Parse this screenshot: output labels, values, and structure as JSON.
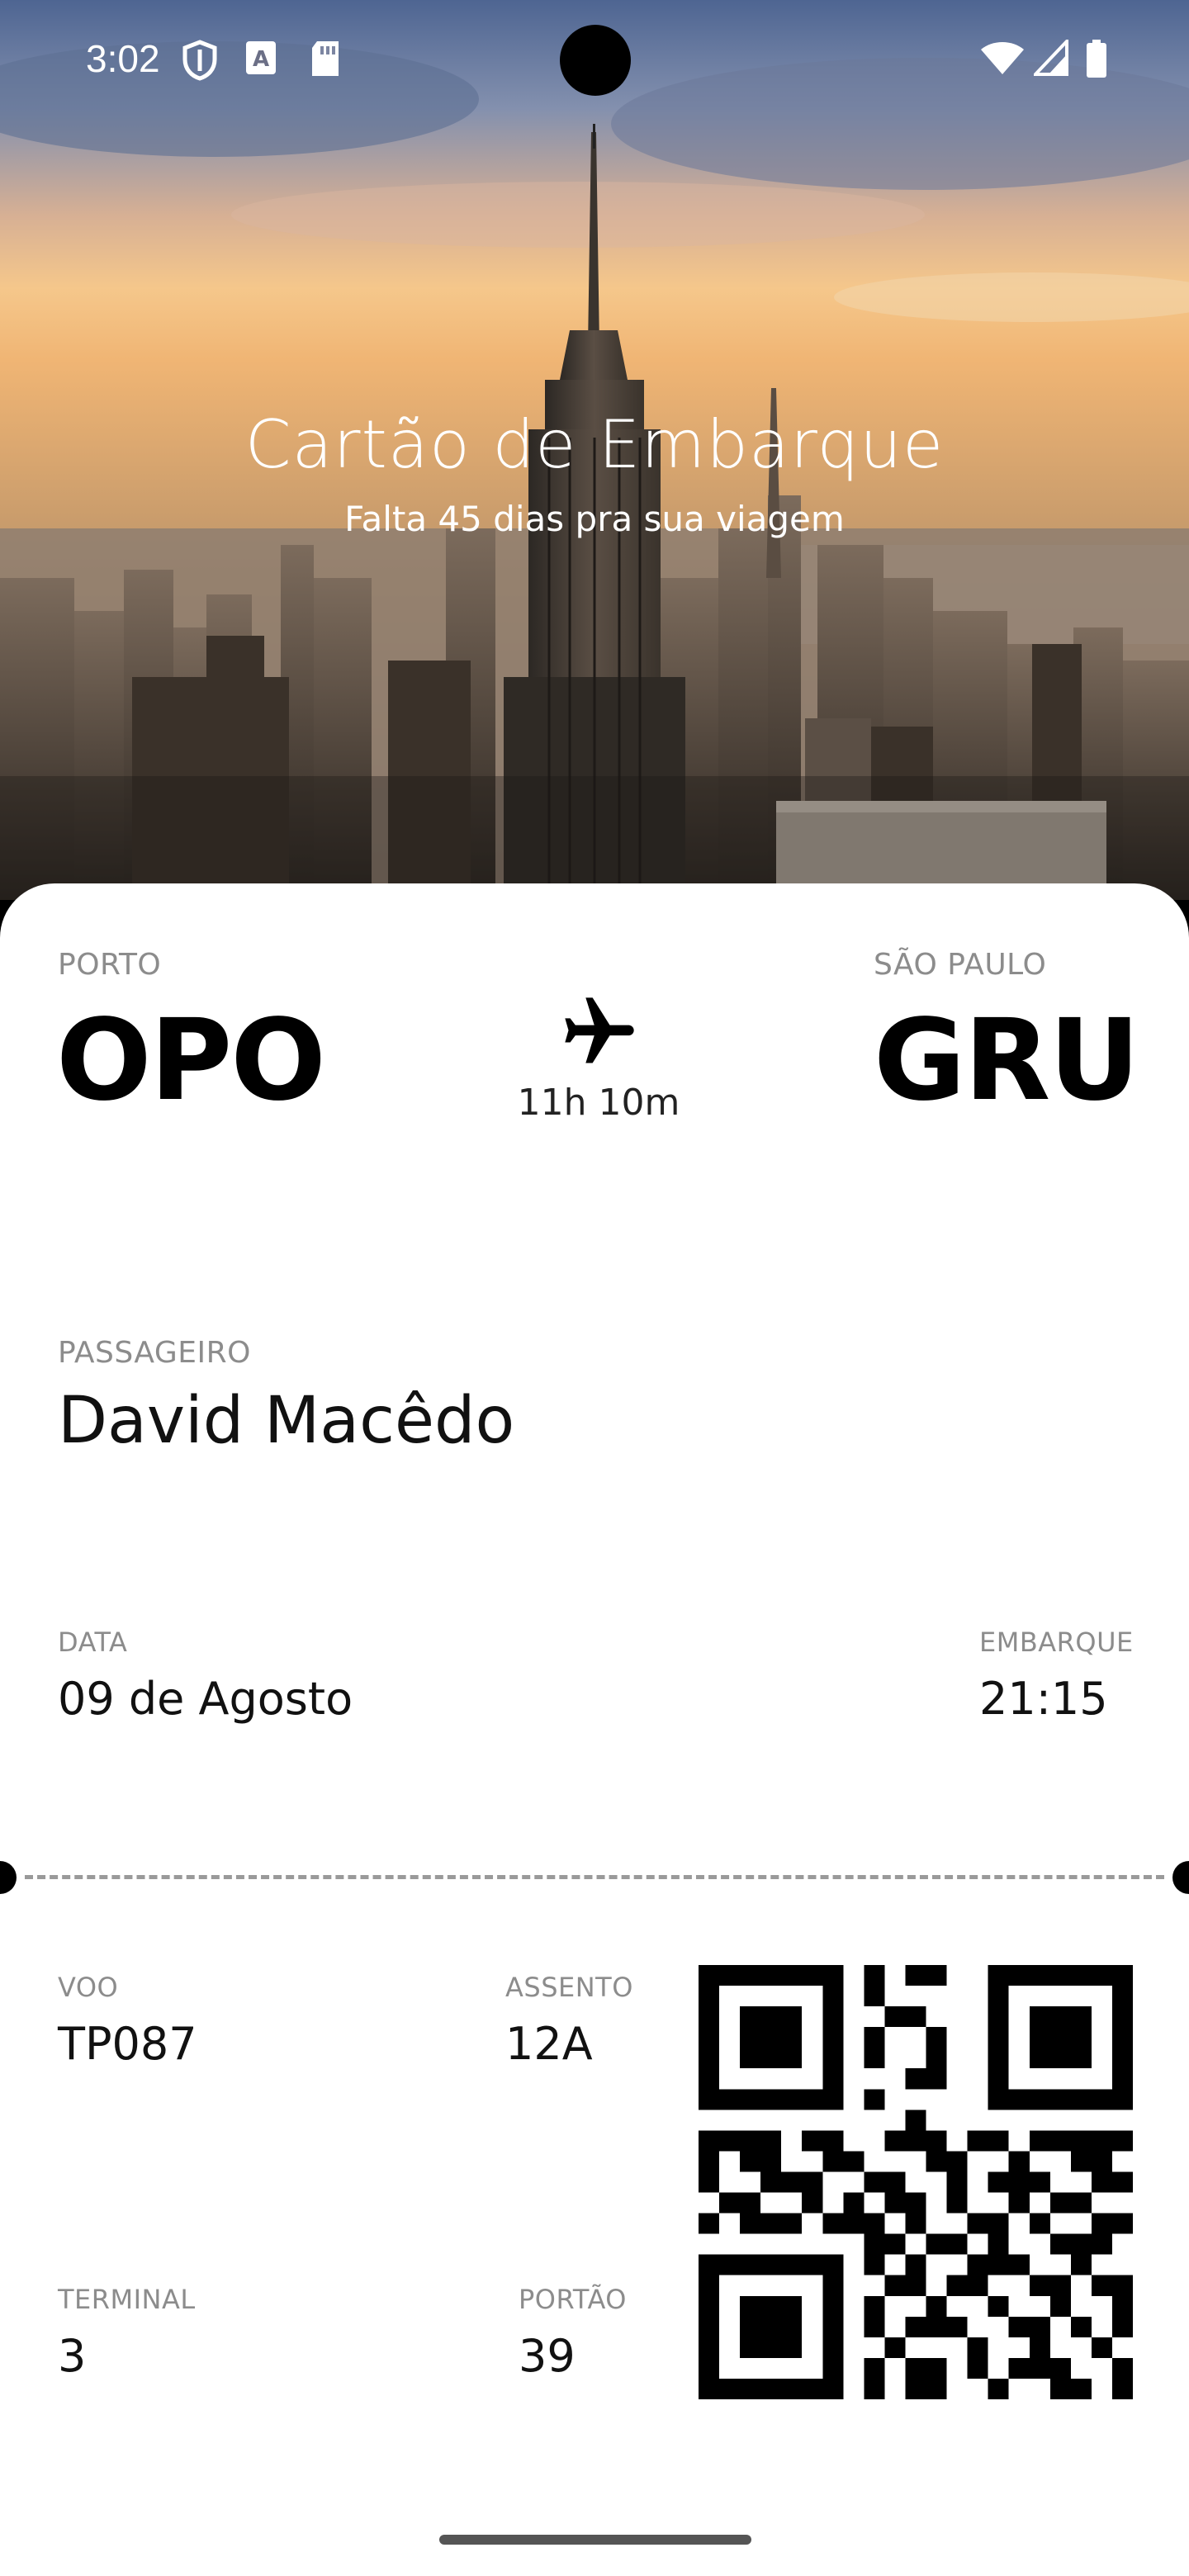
{
  "status_bar": {
    "time": "3:02",
    "left_icons": [
      "shield-icon",
      "text-a-icon",
      "sd-card-icon"
    ],
    "right_icons": [
      "wifi-icon",
      "signal-icon",
      "battery-icon"
    ]
  },
  "hero": {
    "title": "Cartão de Embarque",
    "subtitle": "Falta 45 dias pra sua viagem"
  },
  "flight_route": {
    "origin_city": "PORTO",
    "origin_code": "OPO",
    "destination_city": "SÃO PAULO",
    "destination_code": "GRU",
    "duration": "11h 10m",
    "icon": "airplane-icon"
  },
  "passenger": {
    "label": "PASSAGEIRO",
    "name": "David Macêdo"
  },
  "date": {
    "label": "DATA",
    "value": "09 de Agosto"
  },
  "boarding": {
    "label": "EMBARQUE",
    "value": "21:15"
  },
  "flight": {
    "label": "VOO",
    "value": "TP087"
  },
  "seat": {
    "label": "ASSENTO",
    "value": "12A"
  },
  "terminal": {
    "label": "TERMINAL",
    "value": "3"
  },
  "gate": {
    "label": "PORTÃO",
    "value": "39"
  },
  "colors": {
    "card_background": "#ffffff",
    "label_gray": "#8c8c8c",
    "text_dark": "#111111"
  }
}
